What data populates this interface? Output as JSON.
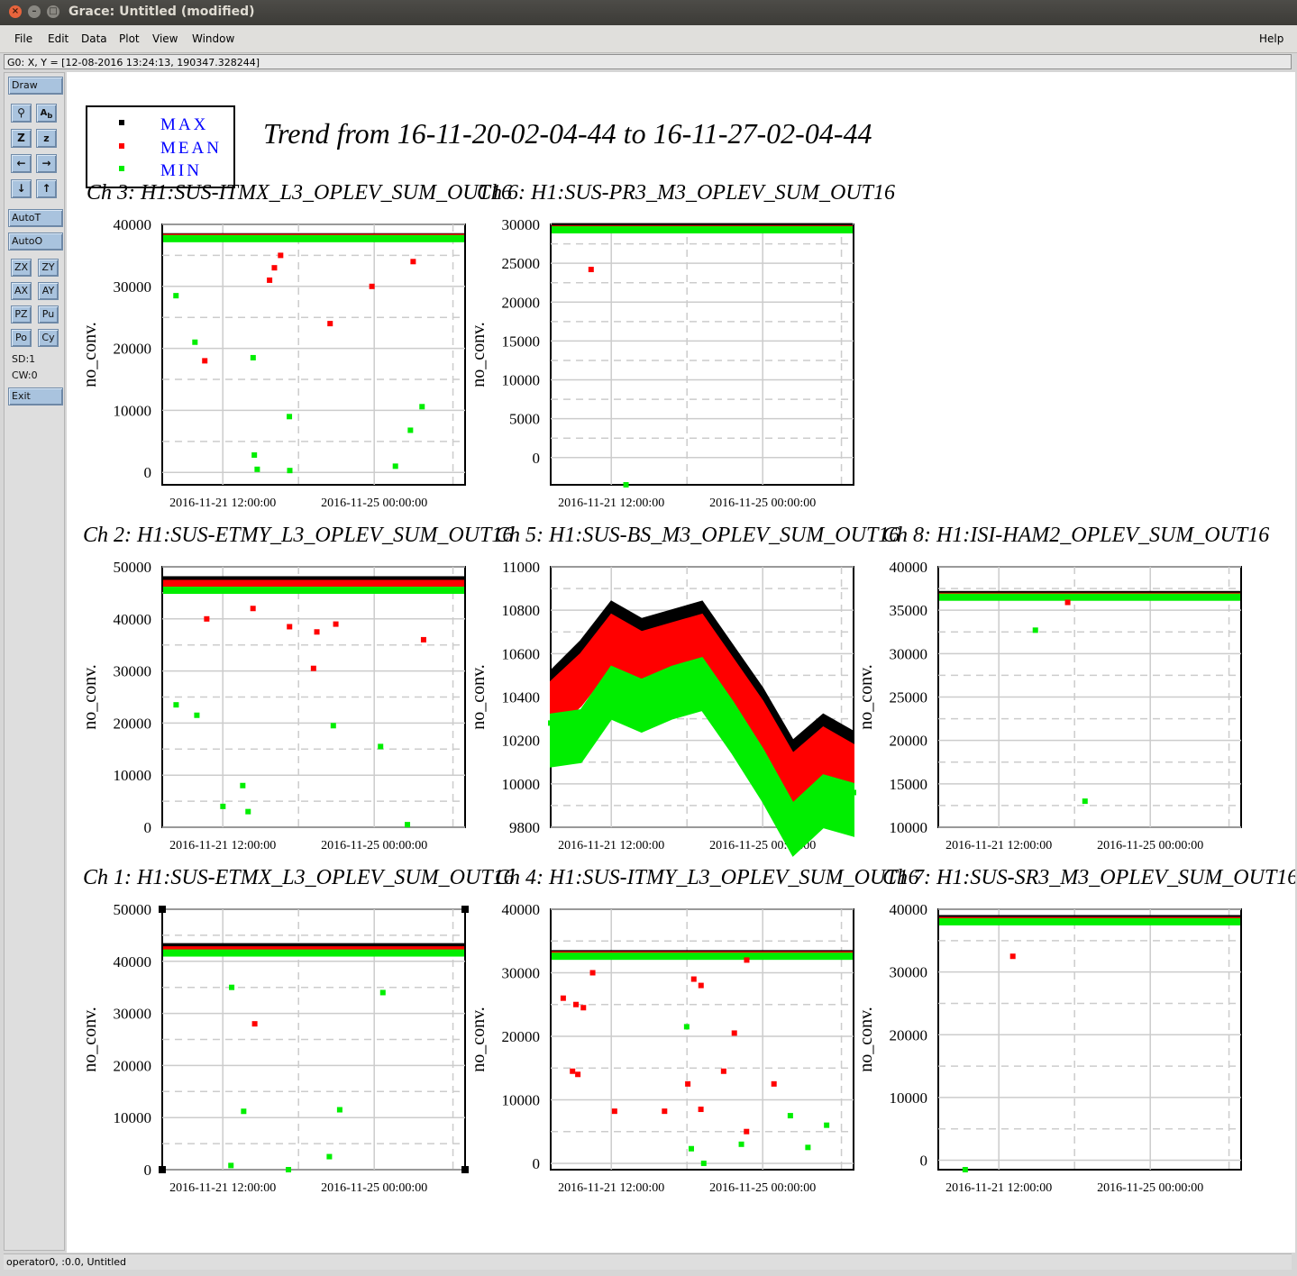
{
  "window": {
    "title": "Grace: Untitled (modified)"
  },
  "menu": {
    "file": "File",
    "edit": "Edit",
    "data": "Data",
    "plot": "Plot",
    "view": "View",
    "window": "Window",
    "help": "Help"
  },
  "locator": "G0: X, Y = [12-08-2016 13:24:13, 190347.328244]",
  "toolbar": {
    "draw": "Draw",
    "autot": "AutoT",
    "autoo": "AutoO",
    "zx": "ZX",
    "zy": "ZY",
    "ax": "AX",
    "ay": "AY",
    "pz": "PZ",
    "pu": "Pu",
    "po": "Po",
    "cy": "Cy",
    "sd": "SD:1",
    "cw": "CW:0",
    "exit": "Exit"
  },
  "status": "operator0, :0.0, Untitled",
  "plot_title": "Trend from 16-11-20-02-04-44 to 16-11-27-02-04-44",
  "legend": [
    {
      "label": "MAX",
      "color": "#000000"
    },
    {
      "label": "MEAN",
      "color": "#ff0000"
    },
    {
      "label": "MIN",
      "color": "#00ee00"
    }
  ],
  "colors": {
    "max": "#000000",
    "mean": "#ff0000",
    "min": "#00ee00",
    "legend_text": "#0000ff",
    "grid": "#cccccc"
  },
  "x_ticks": [
    "2016-11-21 12:00:00",
    "2016-11-25 00:00:00"
  ],
  "chart_data": [
    {
      "type": "scatter",
      "title": "Ch 3: H1:SUS-ITMX_L3_OPLEV_SUM_OUT16",
      "ylabel": "no_conv.",
      "ylim": [
        -2000,
        40000
      ],
      "yticks": [
        0,
        10000,
        20000,
        30000,
        40000
      ],
      "level": {
        "max": 38000,
        "mean": 37900,
        "min": 37700
      },
      "outliers": {
        "mean": [
          35000,
          30000,
          34000,
          31000,
          24000,
          18000,
          33000
        ],
        "min": [
          21000,
          9000,
          6800,
          500,
          1000,
          28500,
          18500,
          10600,
          2800,
          300
        ]
      }
    },
    {
      "type": "scatter",
      "title": "Ch 6: H1:SUS-PR3_M3_OPLEV_SUM_OUT16",
      "ylabel": "no_conv.",
      "ylim": [
        -3500,
        30000
      ],
      "yticks": [
        0,
        5000,
        10000,
        15000,
        20000,
        25000,
        30000
      ],
      "level": {
        "max": 29700,
        "mean": 29400,
        "min": 29300
      },
      "outliers": {
        "mean": [
          24200
        ],
        "min": [
          -3500
        ]
      }
    },
    {
      "type": "scatter",
      "title": "Ch 2: H1:SUS-ETMY_L3_OPLEV_SUM_OUT16",
      "ylabel": "no_conv.",
      "ylim": [
        0,
        50000
      ],
      "yticks": [
        0,
        10000,
        20000,
        30000,
        40000,
        50000
      ],
      "level": {
        "max": 47500,
        "mean": 46800,
        "min": 45500
      },
      "outliers": {
        "mean": [
          38500,
          37500,
          40000,
          39000,
          36000,
          42000,
          30500
        ],
        "min": [
          21500,
          15500,
          23500,
          8000,
          19500,
          4000,
          3000,
          500
        ]
      }
    },
    {
      "type": "line",
      "title": "Ch 5: H1:SUS-BS_M3_OPLEV_SUM_OUT16",
      "ylabel": "no_conv.",
      "ylim": [
        9800,
        11000
      ],
      "yticks": [
        9800,
        10000,
        10200,
        10400,
        10600,
        10800,
        11000
      ],
      "series": [
        {
          "name": "MAX",
          "values": [
            10480,
            10620,
            10800,
            10720,
            10760,
            10800,
            10600,
            10400,
            10160,
            10280,
            10200
          ]
        },
        {
          "name": "MEAN",
          "values": [
            10430,
            10560,
            10740,
            10660,
            10700,
            10740,
            10540,
            10340,
            10100,
            10220,
            10140
          ]
        },
        {
          "name": "MIN",
          "values": [
            10280,
            10300,
            10500,
            10440,
            10500,
            10540,
            10340,
            10120,
            9870,
            10000,
            9960
          ]
        }
      ]
    },
    {
      "type": "scatter",
      "title": "Ch 8: H1:ISI-HAM2_OPLEV_SUM_OUT16",
      "ylabel": "no_conv.",
      "ylim": [
        10000,
        40000
      ],
      "yticks": [
        10000,
        15000,
        20000,
        25000,
        30000,
        35000,
        40000
      ],
      "level": {
        "max": 36800,
        "mean": 36600,
        "min": 36500
      },
      "outliers": {
        "mean": [
          35900
        ],
        "min": [
          32700,
          13000
        ]
      }
    },
    {
      "type": "scatter",
      "title": "Ch 1: H1:SUS-ETMX_L3_OPLEV_SUM_OUT16",
      "ylabel": "no_conv.",
      "ylim": [
        0,
        50000
      ],
      "yticks": [
        0,
        10000,
        20000,
        30000,
        40000,
        50000
      ],
      "level": {
        "max": 42800,
        "mean": 42200,
        "min": 41600
      },
      "outliers": {
        "mean": [
          28000
        ],
        "min": [
          35000,
          11500,
          34000,
          11200,
          2500,
          800,
          0
        ]
      }
    },
    {
      "type": "scatter",
      "title": "Ch 4: H1:SUS-ITMY_L3_OPLEV_SUM_OUT16",
      "ylabel": "no_conv.",
      "ylim": [
        -1000,
        40000
      ],
      "yticks": [
        0,
        10000,
        20000,
        30000,
        40000
      ],
      "level": {
        "max": 33000,
        "mean": 32800,
        "min": 32600
      },
      "outliers": {
        "mean": [
          30000,
          29000,
          24500,
          8500,
          5000,
          8200,
          14500,
          12500,
          14000,
          12500,
          14500,
          8200,
          20500,
          25000,
          28000,
          32000,
          26000
        ],
        "min": [
          21500,
          7500,
          2500,
          2300,
          3000,
          6000,
          0
        ]
      }
    },
    {
      "type": "scatter",
      "title": "Ch 7: H1:SUS-SR3_M3_OPLEV_SUM_OUT16",
      "ylabel": "no_conv.",
      "ylim": [
        -1500,
        40000
      ],
      "yticks": [
        0,
        10000,
        20000,
        30000,
        40000
      ],
      "level": {
        "max": 38500,
        "mean": 38200,
        "min": 38000
      },
      "outliers": {
        "mean": [
          32500
        ],
        "min": [
          -1500
        ]
      }
    }
  ]
}
